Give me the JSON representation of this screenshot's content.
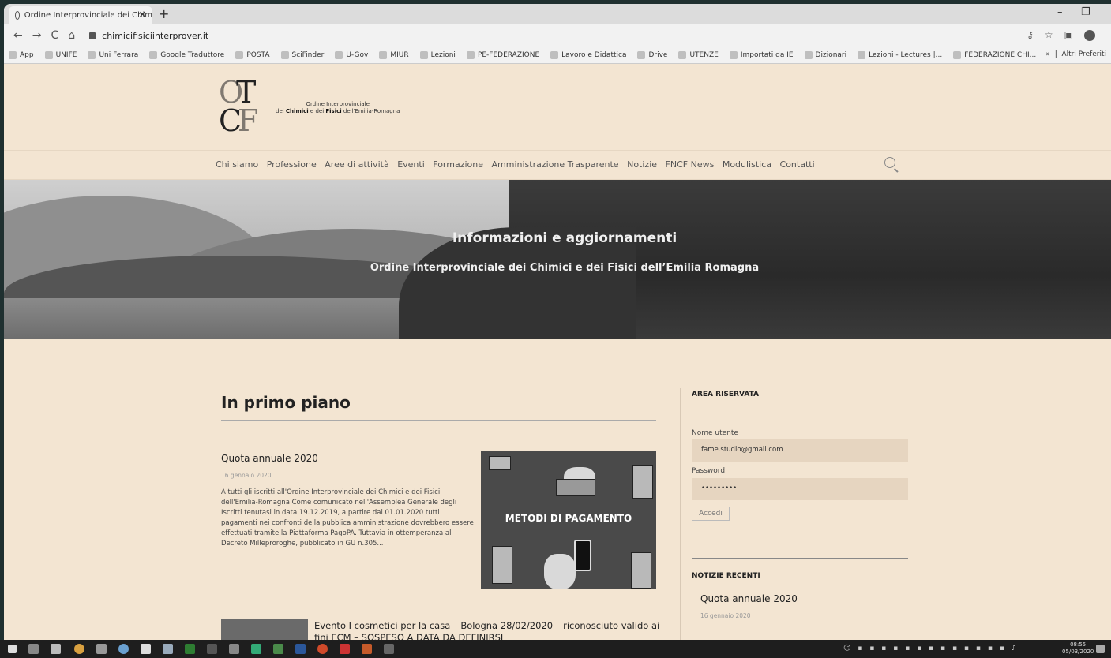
{
  "browser": {
    "tab_title": "Ordine Interprovinciale dei Chim",
    "url": "chimicifisiciinterprover.it",
    "bookmarks": [
      "App",
      "UNIFE",
      "Uni Ferrara",
      "Google Traduttore",
      "POSTA",
      "SciFinder",
      "U-Gov",
      "MIUR",
      "Lezioni",
      "PE-FEDERAZIONE",
      "Lavoro e Didattica",
      "Drive",
      "UTENZE",
      "Importati da IE",
      "Dizionari",
      "Lezioni - Lectures |...",
      "FEDERAZIONE CHI..."
    ],
    "bookmarks_more": "»",
    "bookmarks_other": "Altri Preferiti"
  },
  "site": {
    "logo_line1": "Ordine Interprovinciale",
    "logo_line2_pre": "dei ",
    "logo_line2_b1": "Chimici",
    "logo_line2_mid": " e dei ",
    "logo_line2_b2": "Fisici",
    "logo_line2_post": " dell'Emilia-Romagna",
    "nav": [
      "Chi siamo",
      "Professione",
      "Aree di attività",
      "Eventi",
      "Formazione",
      "Amministrazione Trasparente",
      "Notizie",
      "FNCF News",
      "Modulistica",
      "Contatti"
    ],
    "hero_title": "Informazioni e aggiornamenti",
    "hero_subtitle": "Ordine Interprovinciale dei Chimici e dei Fisici dell’Emilia Romagna"
  },
  "main": {
    "section_title": "In primo piano",
    "post1": {
      "title": "Quota annuale 2020",
      "date": "16 gennaio 2020",
      "excerpt": "A tutti gli iscritti all'Ordine Interprovinciale dei Chimici e dei Fisici dell'Emilia-Romagna Come comunicato nell'Assemblea Generale degli Iscritti tenutasi in data 19.12.2019, a partire dal 01.01.2020 tutti pagamenti nei confronti della pubblica amministrazione dovrebbero essere effettuati tramite la Piattaforma PagoPA. Tuttavia in ottemperanza al Decreto Milleproroghe, pubblicato in GU n.305...",
      "image_label": "METODI DI PAGAMENTO"
    },
    "post2": {
      "title": "Evento I cosmetici per la casa – Bologna 28/02/2020 – riconosciuto valido ai fini ECM – SOSPESO A DATA DA DEFINIRSI"
    }
  },
  "sidebar": {
    "area_title": "AREA RISERVATA",
    "username_label": "Nome utente",
    "username_value": "fame.studio@gmail.com",
    "password_label": "Password",
    "password_value": "•••••••••",
    "login_button": "Accedi",
    "news_title": "NOTIZIE RECENTI",
    "news_item": "Quota annuale 2020",
    "news_date": "16 gennaio 2020"
  },
  "taskbar": {
    "time": "08:55",
    "date": "05/03/2020"
  }
}
